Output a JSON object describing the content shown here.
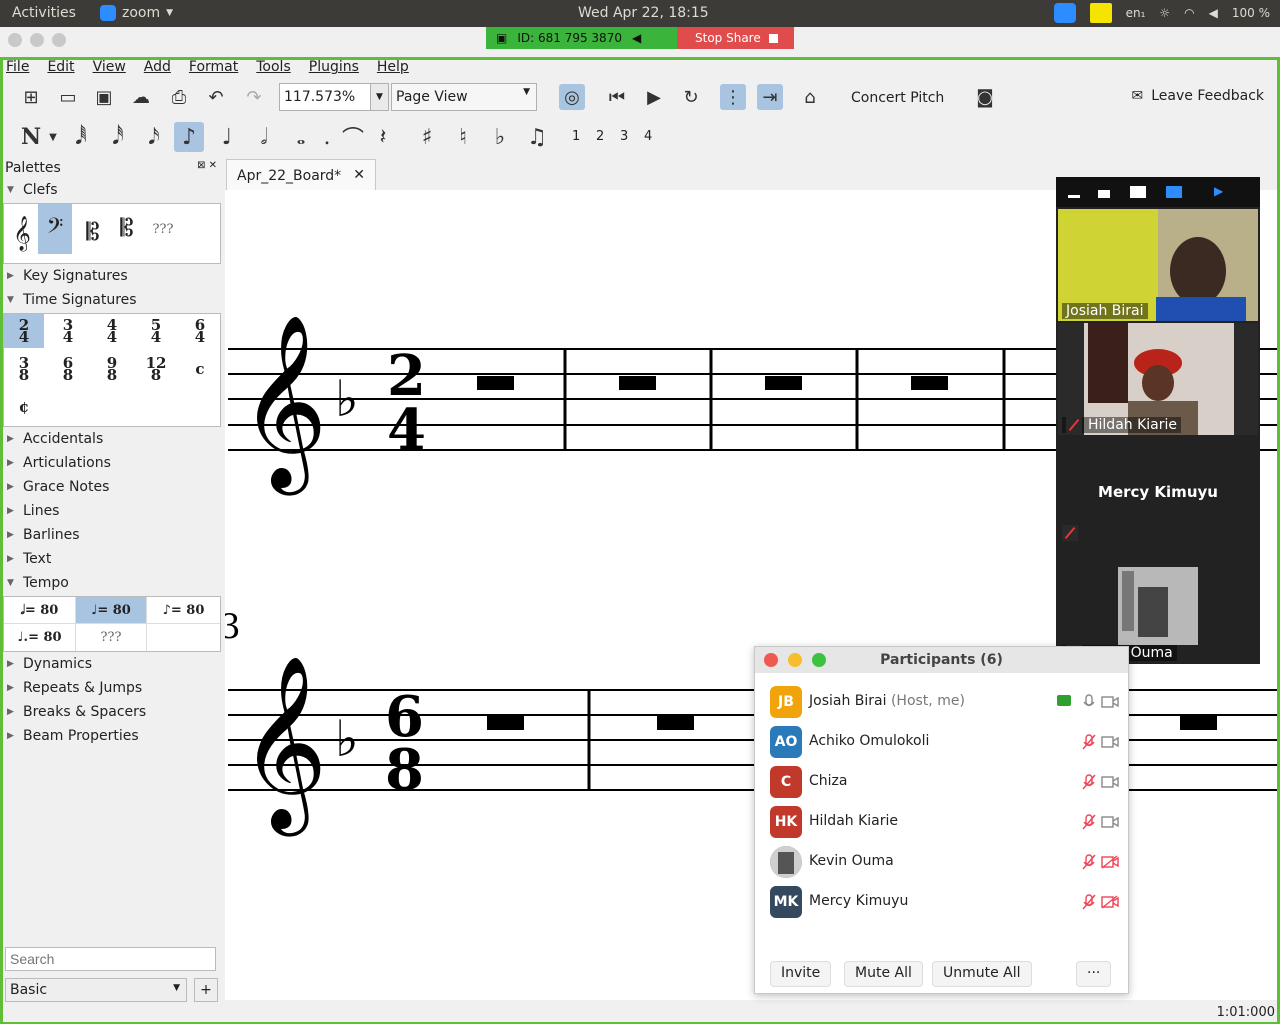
{
  "topbar": {
    "activities": "Activities",
    "app_name": "zoom",
    "clock": "Wed Apr 22, 18:15",
    "lang": "en₁",
    "battery": "100 %"
  },
  "sharebar": {
    "meeting_id": "ID: 681 795 3870",
    "stop_share": "Stop Share"
  },
  "menu": [
    "File",
    "Edit",
    "View",
    "Add",
    "Format",
    "Tools",
    "Plugins",
    "Help"
  ],
  "toolbar": {
    "zoom_value": "117.573%",
    "view_mode": "Page View",
    "concert_pitch": "Concert Pitch",
    "leave_feedback": "Leave Feedback"
  },
  "note_input": {
    "voices": [
      "1",
      "2",
      "3",
      "4"
    ]
  },
  "palettes": {
    "title": "Palettes",
    "sections": {
      "clefs": "Clefs",
      "key_signatures": "Key Signatures",
      "time_signatures": "Time Signatures",
      "accidentals": "Accidentals",
      "articulations": "Articulations",
      "grace_notes": "Grace Notes",
      "lines": "Lines",
      "barlines": "Barlines",
      "text": "Text",
      "tempo": "Tempo",
      "dynamics": "Dynamics",
      "repeats_jumps": "Repeats & Jumps",
      "breaks_spacers": "Breaks & Spacers",
      "beam_properties": "Beam Properties"
    },
    "clef_unknown": "???",
    "time_sigs": [
      {
        "top": "2",
        "bottom": "4"
      },
      {
        "top": "3",
        "bottom": "4"
      },
      {
        "top": "4",
        "bottom": "4"
      },
      {
        "top": "5",
        "bottom": "4"
      },
      {
        "top": "6",
        "bottom": "4"
      },
      {
        "top": "3",
        "bottom": "8"
      },
      {
        "top": "6",
        "bottom": "8"
      },
      {
        "top": "9",
        "bottom": "8"
      },
      {
        "top": "12",
        "bottom": "8"
      },
      {
        "top": "c",
        "bottom": ""
      },
      {
        "top": "¢",
        "bottom": ""
      }
    ],
    "tempo": [
      " = 80",
      " = 80",
      " = 80",
      " = 80",
      "???"
    ],
    "search_placeholder": "Search",
    "workspace": "Basic",
    "add": "+"
  },
  "tab": {
    "label": "Apr_22_Board*",
    "close": "✕"
  },
  "score": {
    "system1": {
      "time_top": "2",
      "time_bottom": "4",
      "key": "♭"
    },
    "system2": {
      "time_top": "6",
      "time_bottom": "8",
      "key": "♭",
      "measure_number": "3"
    }
  },
  "status": {
    "time": "1:01:000"
  },
  "gallery": {
    "tiles": [
      {
        "name": "Josiah Birai"
      },
      {
        "name": "Hildah Kiarie"
      },
      {
        "name": "Mercy Kimuyu"
      },
      {
        "name": "Kevin Ouma"
      }
    ]
  },
  "participants": {
    "title": "Participants (6)",
    "rows": [
      {
        "initials": "JB",
        "name": "Josiah Birai",
        "role": "(Host, me)",
        "color": "#f0a30a"
      },
      {
        "initials": "AO",
        "name": "Achiko Omulokoli",
        "role": "",
        "color": "#2a7ab9"
      },
      {
        "initials": "C",
        "name": "Chiza",
        "role": "",
        "color": "#c0392b"
      },
      {
        "initials": "HK",
        "name": "Hildah Kiarie",
        "role": "",
        "color": "#c0392b"
      },
      {
        "initials": "",
        "name": "Kevin Ouma",
        "role": "",
        "color": "#777777"
      },
      {
        "initials": "MK",
        "name": "Mercy Kimuyu",
        "role": "",
        "color": "#34495e"
      }
    ],
    "buttons": {
      "invite": "Invite",
      "mute_all": "Mute All",
      "unmute_all": "Unmute All",
      "more": "···"
    }
  },
  "colors": {
    "accent_green": "#5fbd38",
    "stop_red": "#e04c4c",
    "select_blue": "#a8c4e0"
  }
}
